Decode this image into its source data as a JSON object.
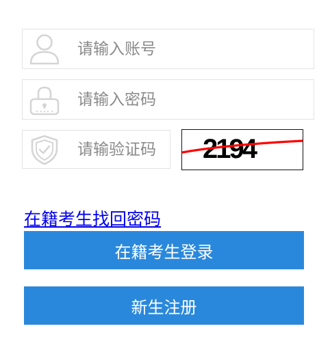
{
  "form": {
    "account": {
      "value": "",
      "placeholder": "请输入账号",
      "icon": "user-icon"
    },
    "password": {
      "value": "",
      "placeholder": "请输入密码",
      "icon": "lock-icon"
    },
    "captcha": {
      "value": "",
      "placeholder": "请输验证码",
      "icon": "shield-icon",
      "image_text": "2194"
    }
  },
  "links": {
    "forgot_password": "在籍考生找回密码"
  },
  "buttons": {
    "login": "在籍考生登录",
    "register": "新生注册"
  },
  "colors": {
    "button_bg": "#2a88dc",
    "link": "#0000ee",
    "captcha_line": "#ff0000",
    "icon": "#d5d5d5"
  }
}
